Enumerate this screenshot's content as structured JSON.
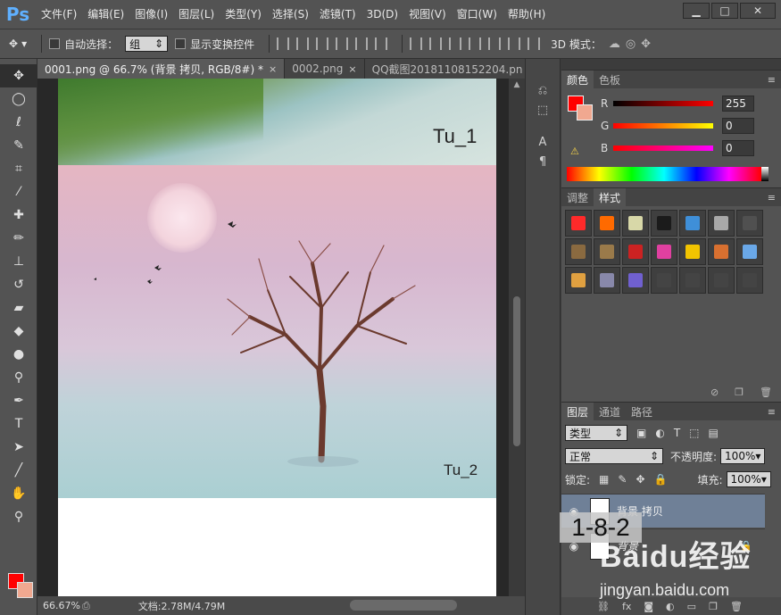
{
  "app": {
    "logo": "Ps"
  },
  "menu": [
    "文件(F)",
    "编辑(E)",
    "图像(I)",
    "图层(L)",
    "类型(Y)",
    "选择(S)",
    "滤镜(T)",
    "3D(D)",
    "视图(V)",
    "窗口(W)",
    "帮助(H)"
  ],
  "window_controls": {
    "minimize": "▁",
    "maximize": "□",
    "close": "✕"
  },
  "options": {
    "auto_select_label": "自动选择：",
    "auto_select_value": "组",
    "show_transform_label": "显示变换控件",
    "mode_3d_label": "3D 模式："
  },
  "tabs": [
    {
      "label": "0001.png @ 66.7% (背景 拷贝, RGB/8#) *",
      "active": true,
      "close": "×"
    },
    {
      "label": "0002.png",
      "active": false,
      "close": "×"
    },
    {
      "label": "QQ截图20181108152204.pn",
      "active": false,
      "close": ""
    }
  ],
  "canvas": {
    "image1_label": "Tu_1",
    "image2_label": "Tu_2"
  },
  "status": {
    "zoom": "66.67%",
    "doc_info": "文档:2.78M/4.79M"
  },
  "color_panel": {
    "tabs": [
      "颜色",
      "色板"
    ],
    "sliders": [
      {
        "label": "R",
        "value": "255"
      },
      {
        "label": "G",
        "value": "0"
      },
      {
        "label": "B",
        "value": "0"
      }
    ],
    "fg": "#ff0000",
    "bg": "#f0a890"
  },
  "styles_panel": {
    "tabs": [
      "调整",
      "样式"
    ],
    "swatches": [
      "#ff2a2a",
      "#ff6a00",
      "#d8d8a8",
      "#1b1b1b",
      "#3f8fd8",
      "#a8a8a8",
      "#505050",
      "#8a6a40",
      "#9a7a4a",
      "#cc2222",
      "#e040a0",
      "#f2c400",
      "#d87030",
      "#6aa8e8",
      "#e0a040",
      "#8888aa",
      "#7060d0",
      "#444444",
      "#444444",
      "#444444",
      "#444444"
    ]
  },
  "layers_panel": {
    "tabs": [
      "图层",
      "通道",
      "路径"
    ],
    "filter_label": "类型",
    "blend_mode": "正常",
    "opacity_label": "不透明度:",
    "opacity_value": "100%",
    "lock_label": "锁定:",
    "fill_label": "填充:",
    "fill_value": "100%",
    "layers": [
      {
        "name": "背景 拷贝",
        "selected": true
      },
      {
        "name": "背景",
        "selected": false
      }
    ]
  },
  "overlay": {
    "step": "1-8-2"
  },
  "watermark": {
    "logo": "Baidu经验",
    "url": "jingyan.baidu.com"
  }
}
